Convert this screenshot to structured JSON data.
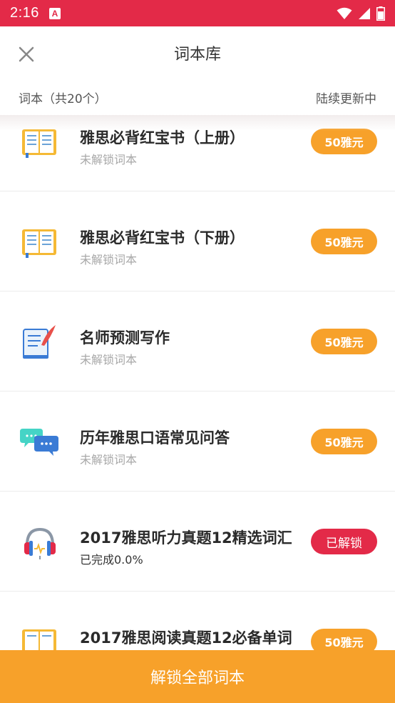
{
  "status_bar": {
    "time": "2:16",
    "notification_letter": "A",
    "background": "#e32a48"
  },
  "header": {
    "title": "词本库",
    "close_icon": "close-icon"
  },
  "subheader": {
    "left": "词本（共20个）",
    "right": "陆续更新中"
  },
  "items": [
    {
      "title": "雅思必背红宝书（上册）",
      "status": "未解锁词本",
      "button": "50雅元",
      "icon": "book-icon",
      "unlocked": false
    },
    {
      "title": "雅思必背红宝书（下册）",
      "status": "未解锁词本",
      "button": "50雅元",
      "icon": "book-icon",
      "unlocked": false
    },
    {
      "title": "名师预测写作",
      "status": "未解锁词本",
      "button": "50雅元",
      "icon": "writing-pen-icon",
      "unlocked": false
    },
    {
      "title": "历年雅思口语常见问答",
      "status": "未解锁词本",
      "button": "50雅元",
      "icon": "chat-bubbles-icon",
      "unlocked": false
    },
    {
      "title": "2017雅思听力真题12精选词汇",
      "status": "已完成0.0%",
      "button": "已解锁",
      "icon": "headphones-icon",
      "unlocked": true
    },
    {
      "title": "2017雅思阅读真题12必备单词",
      "status": "",
      "button": "50雅元",
      "icon": "book-icon",
      "unlocked": false
    }
  ],
  "bottom_button": "解锁全部词本",
  "colors": {
    "accent_orange": "#f7a12a",
    "accent_red": "#e32a48"
  }
}
